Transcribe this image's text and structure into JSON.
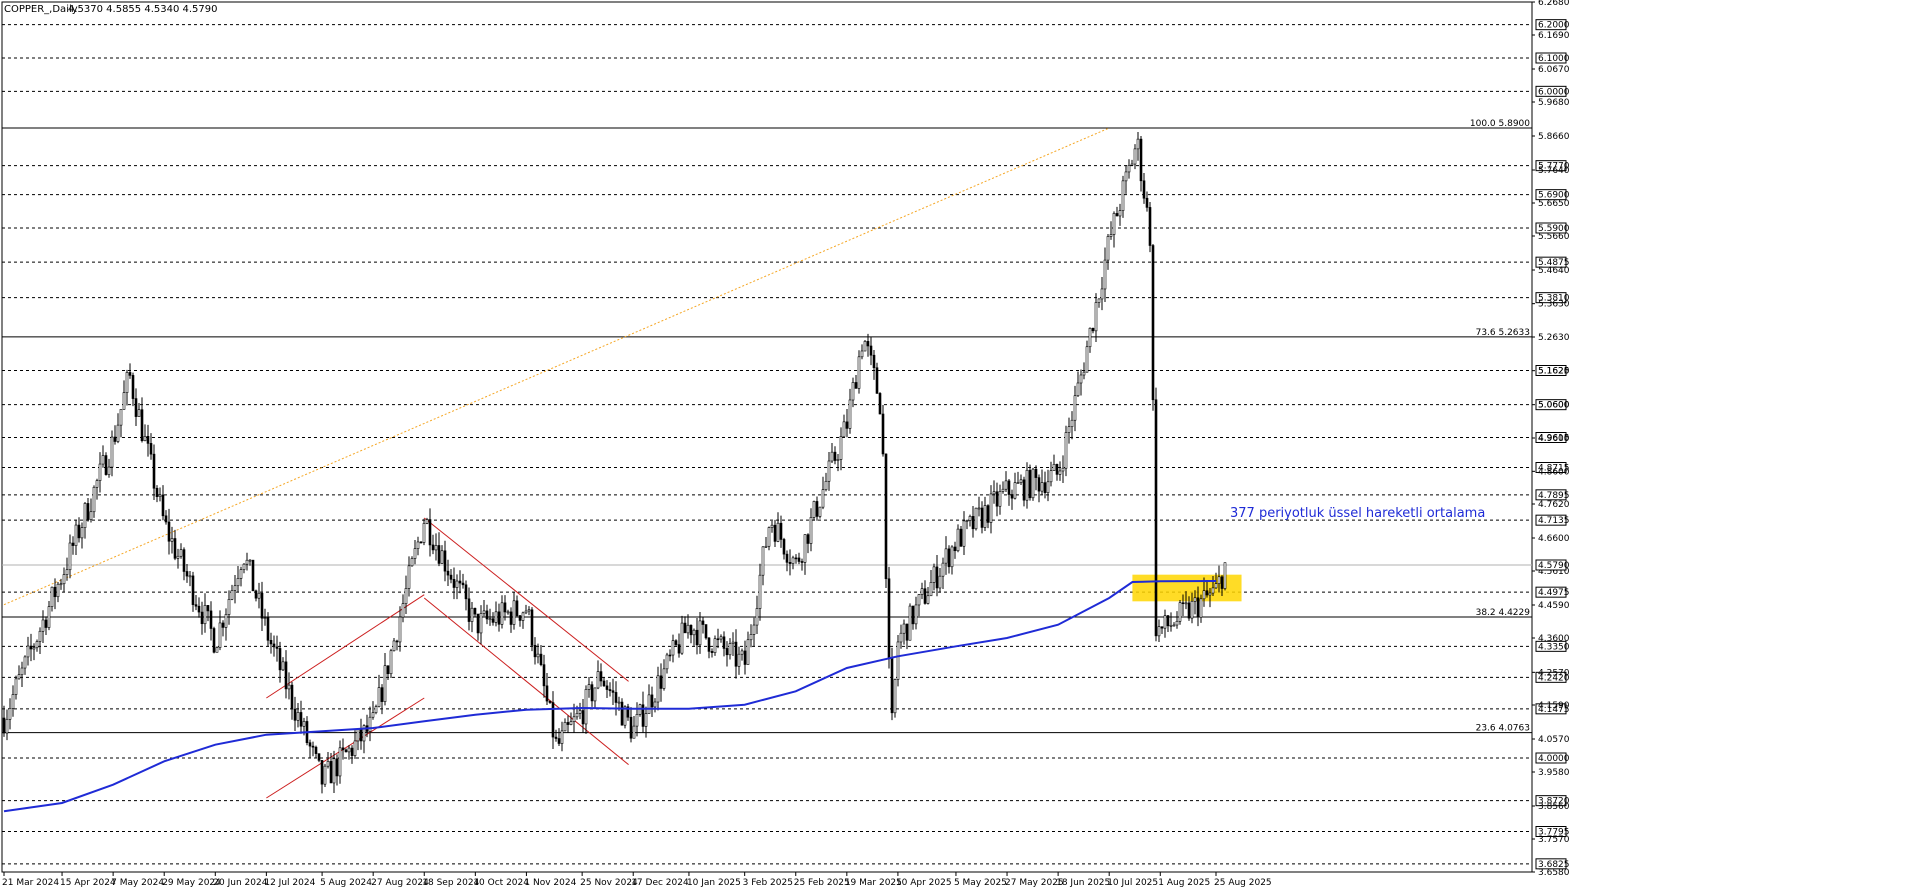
{
  "header": {
    "symbol": "COPPER_,Daily",
    "ohlc": "4.5370 4.5855 4.5340 4.5790"
  },
  "chart_data": {
    "type": "candlestick",
    "title": "",
    "symbol": "COPPER_",
    "timeframe": "Daily",
    "ylim": [
      3.658,
      6.268
    ],
    "price_ticks": [
      "6.2680",
      "6.1690",
      "6.0670",
      "5.9680",
      "5.8660",
      "5.7640",
      "5.6650",
      "5.5660",
      "5.4640",
      "5.3630",
      "5.2630",
      "5.1620",
      "5.0600",
      "4.9600",
      "4.8600",
      "4.7620",
      "4.6600",
      "4.5610",
      "4.4590",
      "4.3600",
      "4.2570",
      "4.1590",
      "4.0570",
      "3.9580",
      "3.8560",
      "3.7570",
      "3.6580"
    ],
    "x_ticks": [
      "21 Mar 2024",
      "15 Apr 2024",
      "7 May 2024",
      "29 May 2024",
      "20 Jun 2024",
      "12 Jul 2024",
      "5 Aug 2024",
      "27 Aug 2024",
      "18 Sep 2024",
      "10 Oct 2024",
      "1 Nov 2024",
      "25 Nov 2024",
      "17 Dec 2024",
      "10 Jan 2025",
      "3 Feb 2025",
      "25 Feb 2025",
      "19 Mar 2025",
      "10 Apr 2025",
      "5 May 2025",
      "27 May 2025",
      "18 Jun 2025",
      "10 Jul 2025",
      "1 Aug 2025",
      "25 Aug 2025"
    ],
    "horizontal_levels": [
      "6.2000",
      "6.1000",
      "6.0000",
      "5.7770",
      "5.6900",
      "5.5900",
      "5.4875",
      "5.3810",
      "5.1625",
      "5.0600",
      "4.9615",
      "4.8715",
      "4.7895",
      "4.7135",
      "4.4975",
      "4.3350",
      "4.2420",
      "4.1475",
      "4.0000",
      "3.8720",
      "3.7795",
      "3.6825"
    ],
    "current_price": "4.5790",
    "fibonacci_levels": [
      {
        "label": "100.0 5.8900",
        "price": 5.89
      },
      {
        "label": "73.6 5.2633",
        "price": 5.2633
      },
      {
        "label": "38.2 4.4229",
        "price": 4.4229
      },
      {
        "label": "23.6 4.0763",
        "price": 4.0763
      }
    ],
    "annotation": "377 periyotluk üssel hareketli ortalama",
    "ema_period": 377,
    "highlight_zone": {
      "from_date": "20 Jul 2025",
      "to_date": "5 Sep 2025",
      "low": 4.47,
      "high": 4.55,
      "color": "#ffd600"
    },
    "ema_points": [
      [
        "21 Mar 2024",
        3.84
      ],
      [
        "15 Apr 2024",
        3.865
      ],
      [
        "7 May 2024",
        3.92
      ],
      [
        "29 May 2024",
        3.99
      ],
      [
        "20 Jun 2024",
        4.04
      ],
      [
        "12 Jul 2024",
        4.07
      ],
      [
        "5 Aug 2024",
        4.08
      ],
      [
        "27 Aug 2024",
        4.09
      ],
      [
        "18 Sep 2024",
        4.11
      ],
      [
        "10 Oct 2024",
        4.13
      ],
      [
        "1 Nov 2024",
        4.145
      ],
      [
        "25 Nov 2024",
        4.15
      ],
      [
        "17 Dec 2024",
        4.148
      ],
      [
        "10 Jan 2025",
        4.148
      ],
      [
        "3 Feb 2025",
        4.16
      ],
      [
        "25 Feb 2025",
        4.2
      ],
      [
        "19 Mar 2025",
        4.27
      ],
      [
        "10 Apr 2025",
        4.305
      ],
      [
        "5 May 2025",
        4.335
      ],
      [
        "27 May 2025",
        4.36
      ],
      [
        "18 Jun 2025",
        4.4
      ],
      [
        "10 Jul 2025",
        4.48
      ],
      [
        "20 Jul 2025",
        4.528
      ],
      [
        "1 Aug 2025",
        4.53
      ],
      [
        "25 Aug 2025",
        4.531
      ]
    ],
    "price_path": [
      [
        "21 Mar 2024",
        4.12
      ],
      [
        "15 Apr 2024",
        4.55
      ],
      [
        "7 May 2024",
        4.95
      ],
      [
        "14 May 2024",
        5.15
      ],
      [
        "29 May 2024",
        4.7
      ],
      [
        "20 Jun 2024",
        4.35
      ],
      [
        "2 Jul 2024",
        4.62
      ],
      [
        "12 Jul 2024",
        4.38
      ],
      [
        "5 Aug 2024",
        3.93
      ],
      [
        "27 Aug 2024",
        4.1
      ],
      [
        "18 Sep 2024",
        4.72
      ],
      [
        "10 Oct 2024",
        4.4
      ],
      [
        "1 Nov 2024",
        4.45
      ],
      [
        "14 Nov 2024",
        4.03
      ],
      [
        "25 Nov 2024",
        4.14
      ],
      [
        "3 Dec 2024",
        4.25
      ],
      [
        "17 Dec 2024",
        4.08
      ],
      [
        "10 Jan 2025",
        4.4
      ],
      [
        "3 Feb 2025",
        4.28
      ],
      [
        "14 Feb 2025",
        4.72
      ],
      [
        "25 Feb 2025",
        4.58
      ],
      [
        "19 Mar 2025",
        5.0
      ],
      [
        "26 Mar 2025",
        5.27
      ],
      [
        "3 Apr 2025",
        5.05
      ],
      [
        "7 Apr 2025",
        4.05
      ],
      [
        "10 Apr 2025",
        4.35
      ],
      [
        "5 May 2025",
        4.65
      ],
      [
        "27 May 2025",
        4.8
      ],
      [
        "18 Jun 2025",
        4.85
      ],
      [
        "28 Jun 2025",
        5.15
      ],
      [
        "10 Jul 2025",
        5.55
      ],
      [
        "22 Jul 2025",
        5.85
      ],
      [
        "28 Jul 2025",
        5.55
      ],
      [
        "30 Jul 2025",
        4.4
      ],
      [
        "1 Aug 2025",
        4.38
      ],
      [
        "25 Aug 2025",
        4.5
      ],
      [
        "29 Aug 2025",
        4.58
      ]
    ],
    "channels": [
      {
        "name": "rising channel",
        "color": "#cc1f1f",
        "lines": [
          [
            [
              "12 Jul 2024",
              4.18
            ],
            [
              "18 Sep 2024",
              4.49
            ]
          ],
          [
            [
              "12 Jul 2024",
              3.88
            ],
            [
              "18 Sep 2024",
              4.18
            ]
          ]
        ]
      },
      {
        "name": "falling channel",
        "color": "#cc1f1f",
        "lines": [
          [
            [
              "18 Sep 2024",
              4.72
            ],
            [
              "15 Dec 2024",
              4.23
            ]
          ],
          [
            [
              "18 Sep 2024",
              4.48
            ],
            [
              "15 Dec 2024",
              3.98
            ]
          ]
        ]
      }
    ],
    "trendline": {
      "color": "#f5a623",
      "from": [
        "21 Mar 2024",
        4.46
      ],
      "to": [
        "10 Jul 2025",
        5.89
      ]
    }
  }
}
